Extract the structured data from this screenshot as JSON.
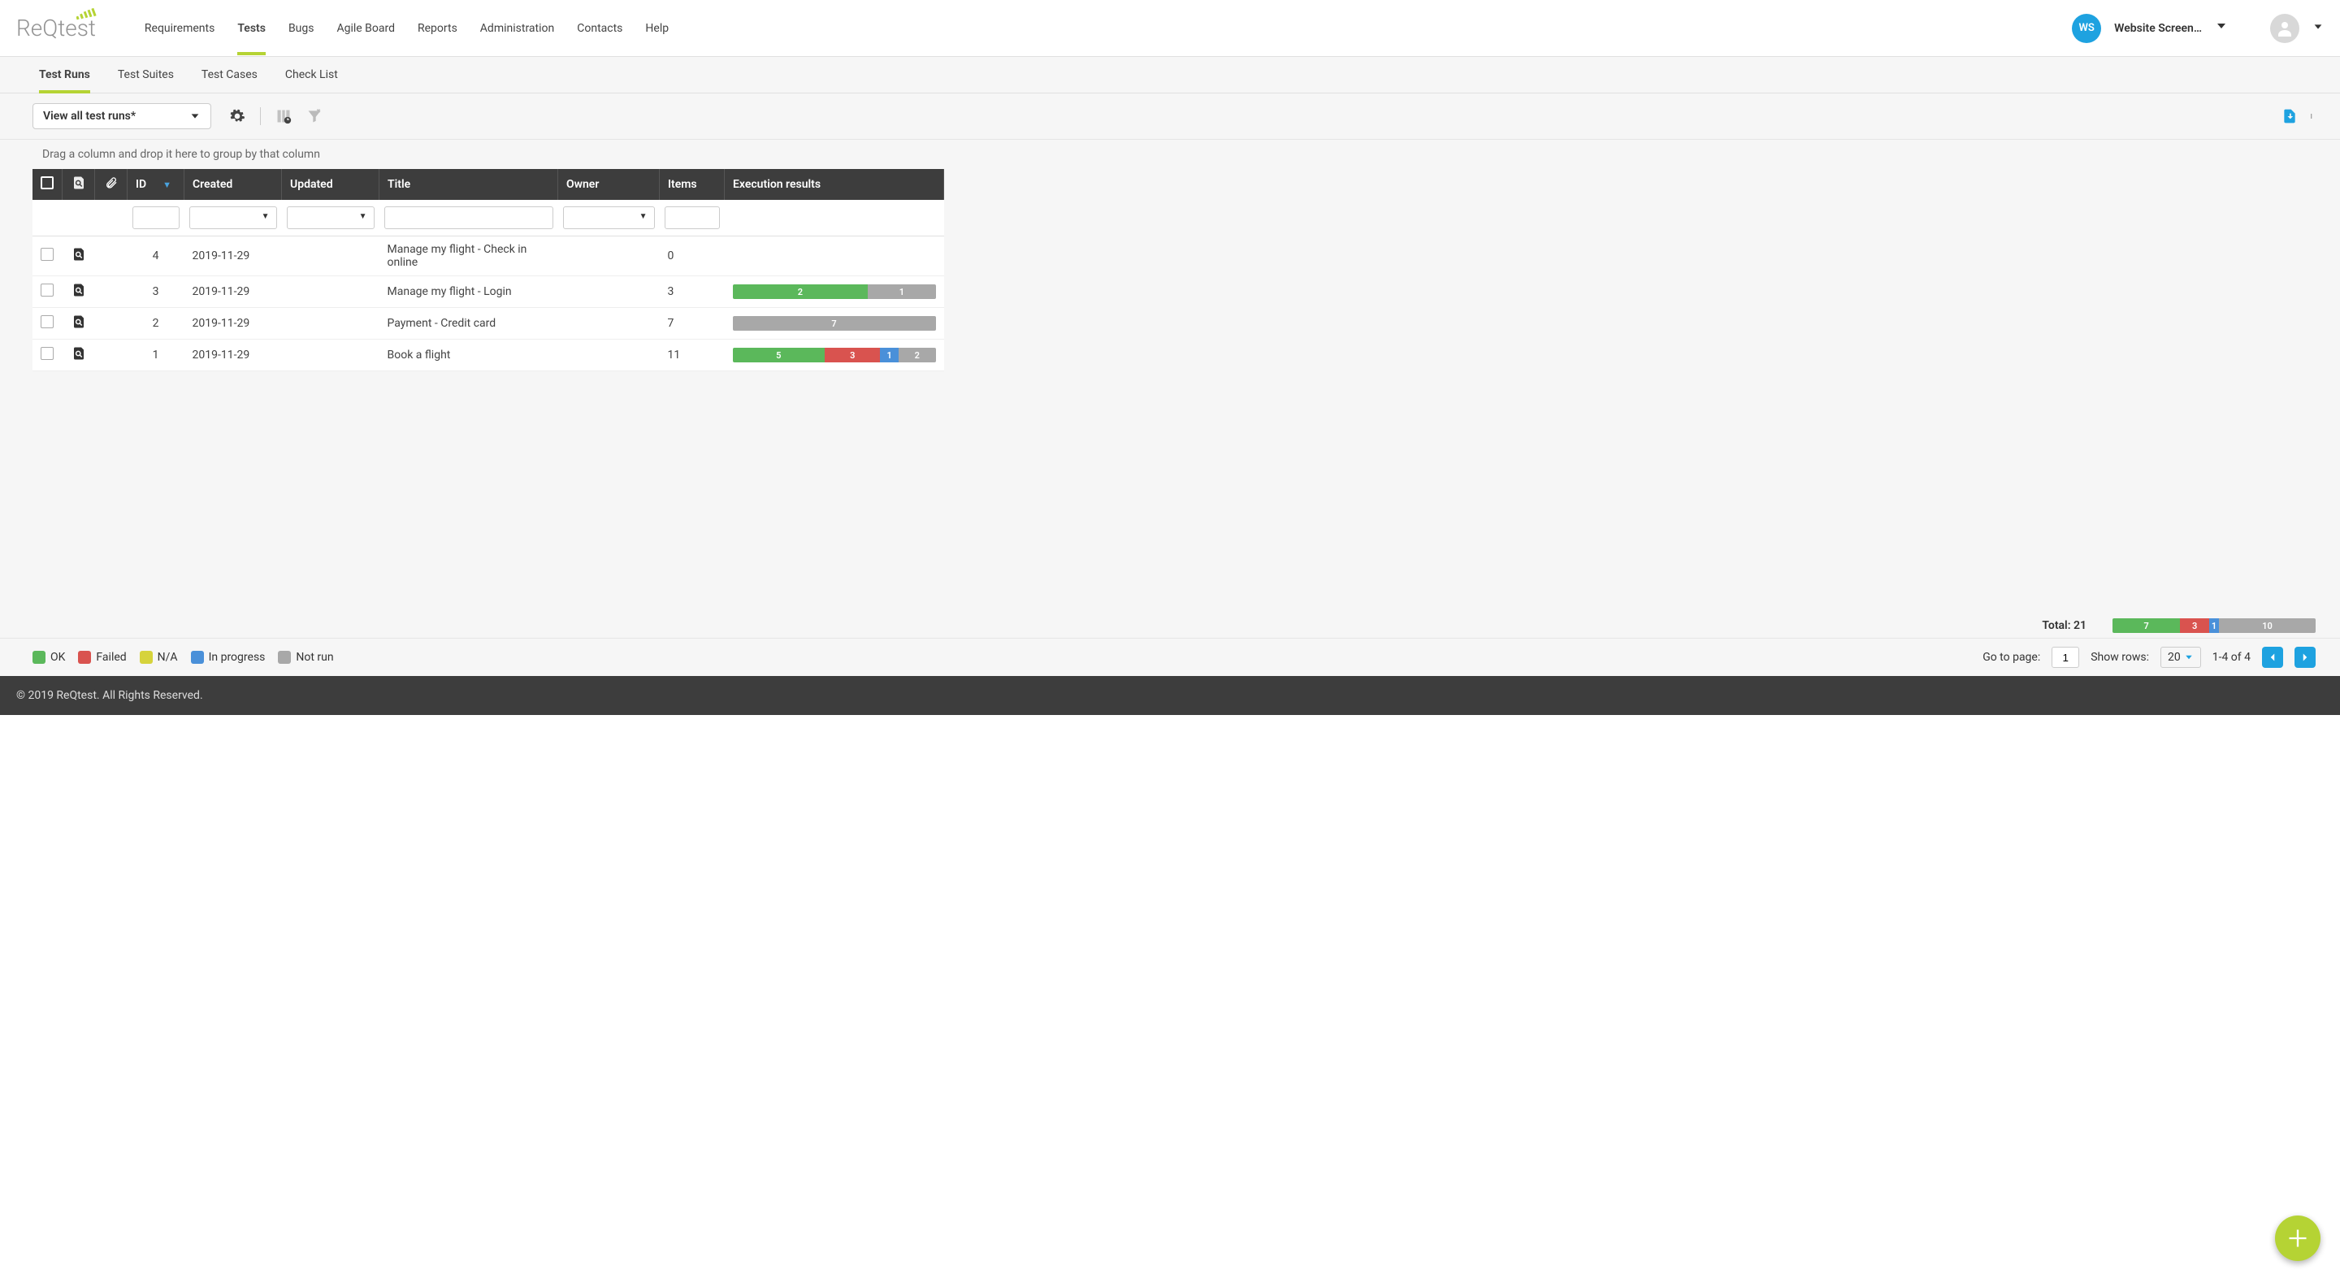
{
  "header": {
    "logo_text": "ReQtest",
    "nav": [
      "Requirements",
      "Tests",
      "Bugs",
      "Agile Board",
      "Reports",
      "Administration",
      "Contacts",
      "Help"
    ],
    "nav_active": "Tests",
    "ws_initials": "WS",
    "project_name": "Website Screen…"
  },
  "tabs": {
    "items": [
      "Test Runs",
      "Test Suites",
      "Test Cases",
      "Check List"
    ],
    "active": "Test Runs"
  },
  "toolbar": {
    "view_label": "View all test runs*"
  },
  "grouping_hint": "Drag a column and drop it here to group by that column",
  "columns": [
    "",
    "",
    "",
    "ID",
    "Created",
    "Updated",
    "Title",
    "Owner",
    "Items",
    "Execution results"
  ],
  "rows": [
    {
      "id": "4",
      "created": "2019-11-29",
      "updated": "",
      "title": "Manage my flight - Check in online",
      "owner": "",
      "items": "0",
      "exec": []
    },
    {
      "id": "3",
      "created": "2019-11-29",
      "updated": "",
      "title": "Manage my flight - Login",
      "owner": "",
      "items": "3",
      "exec": [
        {
          "v": 2,
          "k": "ok"
        },
        {
          "v": 1,
          "k": "notrun"
        }
      ]
    },
    {
      "id": "2",
      "created": "2019-11-29",
      "updated": "",
      "title": "Payment - Credit card",
      "owner": "",
      "items": "7",
      "exec": [
        {
          "v": 7,
          "k": "notrun"
        }
      ]
    },
    {
      "id": "1",
      "created": "2019-11-29",
      "updated": "",
      "title": "Book a flight",
      "owner": "",
      "items": "11",
      "exec": [
        {
          "v": 5,
          "k": "ok"
        },
        {
          "v": 3,
          "k": "fail"
        },
        {
          "v": 1,
          "k": "prog"
        },
        {
          "v": 2,
          "k": "notrun"
        }
      ]
    }
  ],
  "total": {
    "label": "Total: 21",
    "exec": [
      {
        "v": 7,
        "k": "ok"
      },
      {
        "v": 3,
        "k": "fail"
      },
      {
        "v": 1,
        "k": "prog"
      },
      {
        "v": 10,
        "k": "notrun"
      }
    ],
    "sum": 21
  },
  "legend": [
    {
      "label": "OK",
      "k": "ok",
      "c": "#5bb85b"
    },
    {
      "label": "Failed",
      "k": "fail",
      "c": "#d9534f"
    },
    {
      "label": "N/A",
      "k": "na",
      "c": "#d6d33b"
    },
    {
      "label": "In progress",
      "k": "prog",
      "c": "#4a90d9"
    },
    {
      "label": "Not run",
      "k": "notrun",
      "c": "#a8a8a8"
    }
  ],
  "pagination": {
    "goto_label": "Go to page:",
    "page": "1",
    "rows_label": "Show rows:",
    "rows": "20",
    "range": "1-4 of 4"
  },
  "copyright": "© 2019 ReQtest. All Rights Reserved."
}
